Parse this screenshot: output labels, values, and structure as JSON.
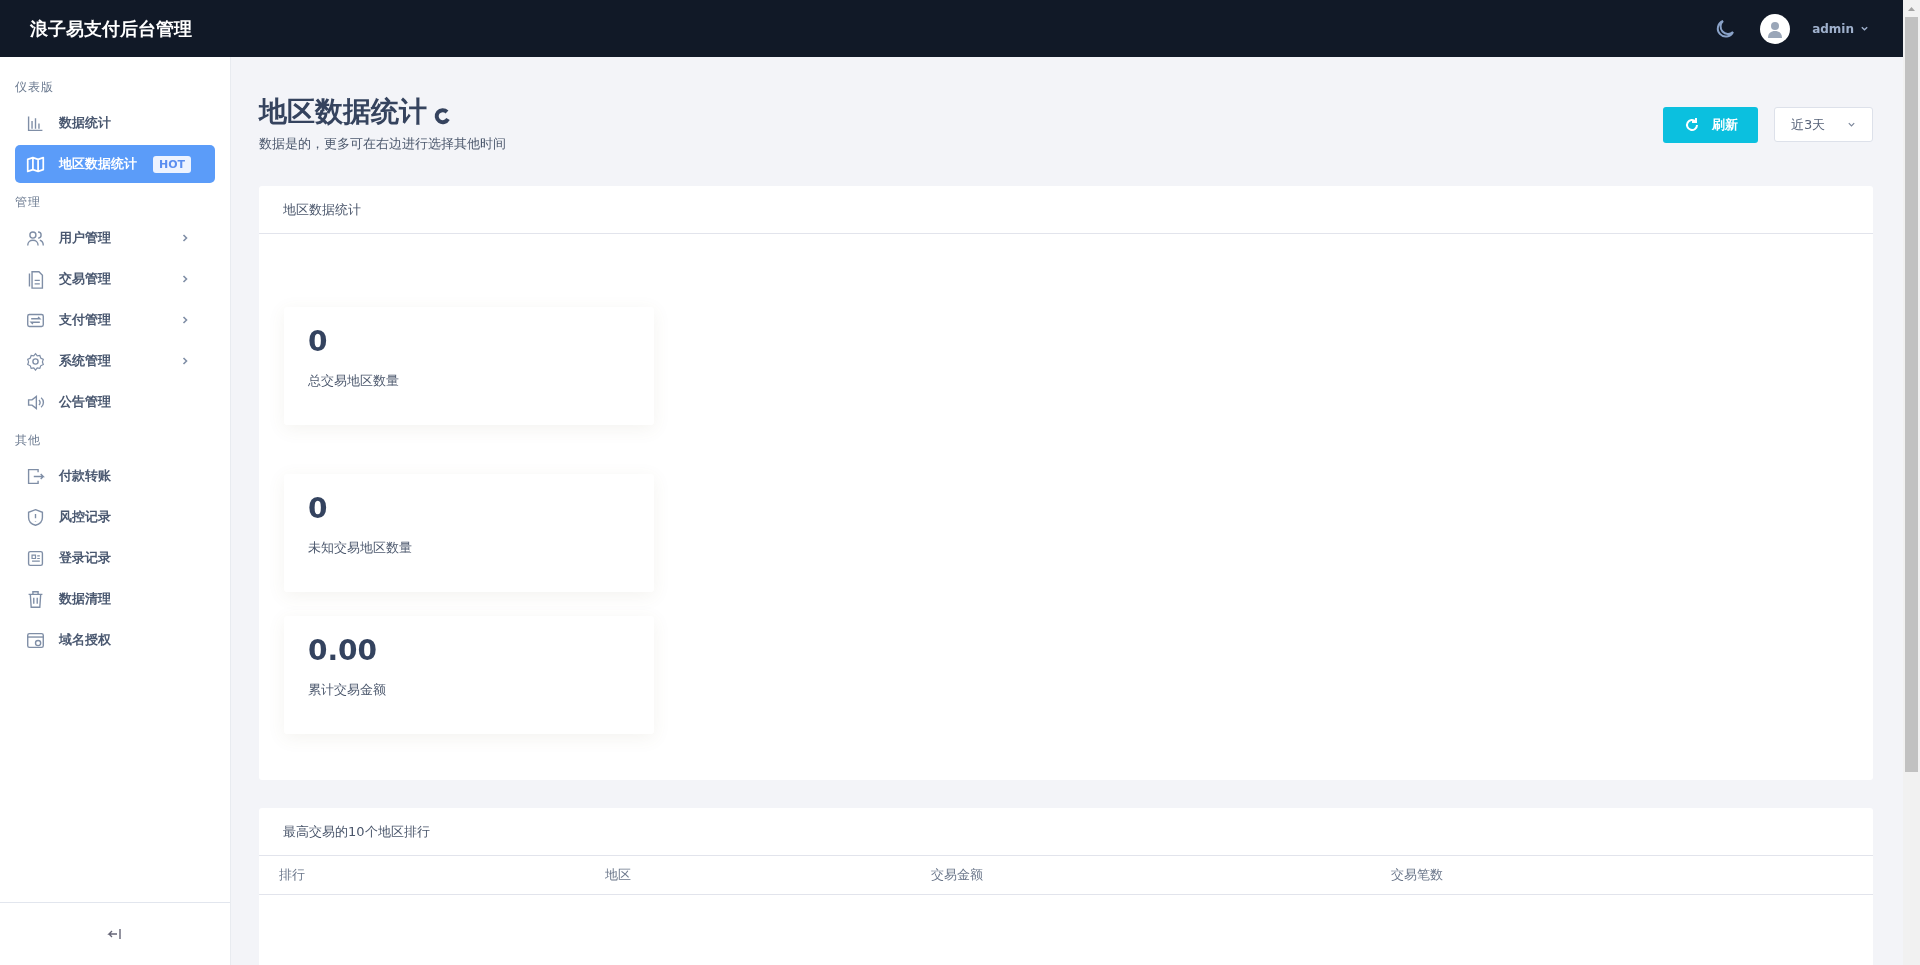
{
  "header": {
    "title": "浪子易支付后台管理",
    "user": {
      "name": "admin"
    }
  },
  "sidebar": {
    "sections": [
      {
        "title": "仪表版",
        "items": [
          {
            "label": "数据统计",
            "selected": false,
            "expandable": false
          },
          {
            "label": "地区数据统计",
            "selected": true,
            "expandable": false,
            "badge": "HOT"
          }
        ]
      },
      {
        "title": "管理",
        "items": [
          {
            "label": "用户管理",
            "selected": false,
            "expandable": true
          },
          {
            "label": "交易管理",
            "selected": false,
            "expandable": true
          },
          {
            "label": "支付管理",
            "selected": false,
            "expandable": true
          },
          {
            "label": "系统管理",
            "selected": false,
            "expandable": true
          },
          {
            "label": "公告管理",
            "selected": false,
            "expandable": false
          }
        ]
      },
      {
        "title": "其他",
        "items": [
          {
            "label": "付款转账",
            "selected": false,
            "expandable": false
          },
          {
            "label": "风控记录",
            "selected": false,
            "expandable": false
          },
          {
            "label": "登录记录",
            "selected": false,
            "expandable": false
          },
          {
            "label": "数据清理",
            "selected": false,
            "expandable": false
          },
          {
            "label": "域名授权",
            "selected": false,
            "expandable": false
          }
        ]
      }
    ]
  },
  "page": {
    "title": "地区数据统计",
    "subtitle": "数据是的，更多可在右边进行选择其他时间",
    "refresh_button": "刷新",
    "range_select": {
      "value": "近3天"
    }
  },
  "stats_panel": {
    "title": "地区数据统计",
    "stats": [
      {
        "value": "0",
        "label": "总交易地区数量"
      },
      {
        "value": "0",
        "label": "未知交易地区数量"
      },
      {
        "value": "0.00",
        "label": "累计交易金额"
      }
    ]
  },
  "ranking_table": {
    "title": "最高交易的10个地区排行",
    "columns": [
      "排行",
      "地区",
      "交易金额",
      "交易笔数"
    ]
  }
}
